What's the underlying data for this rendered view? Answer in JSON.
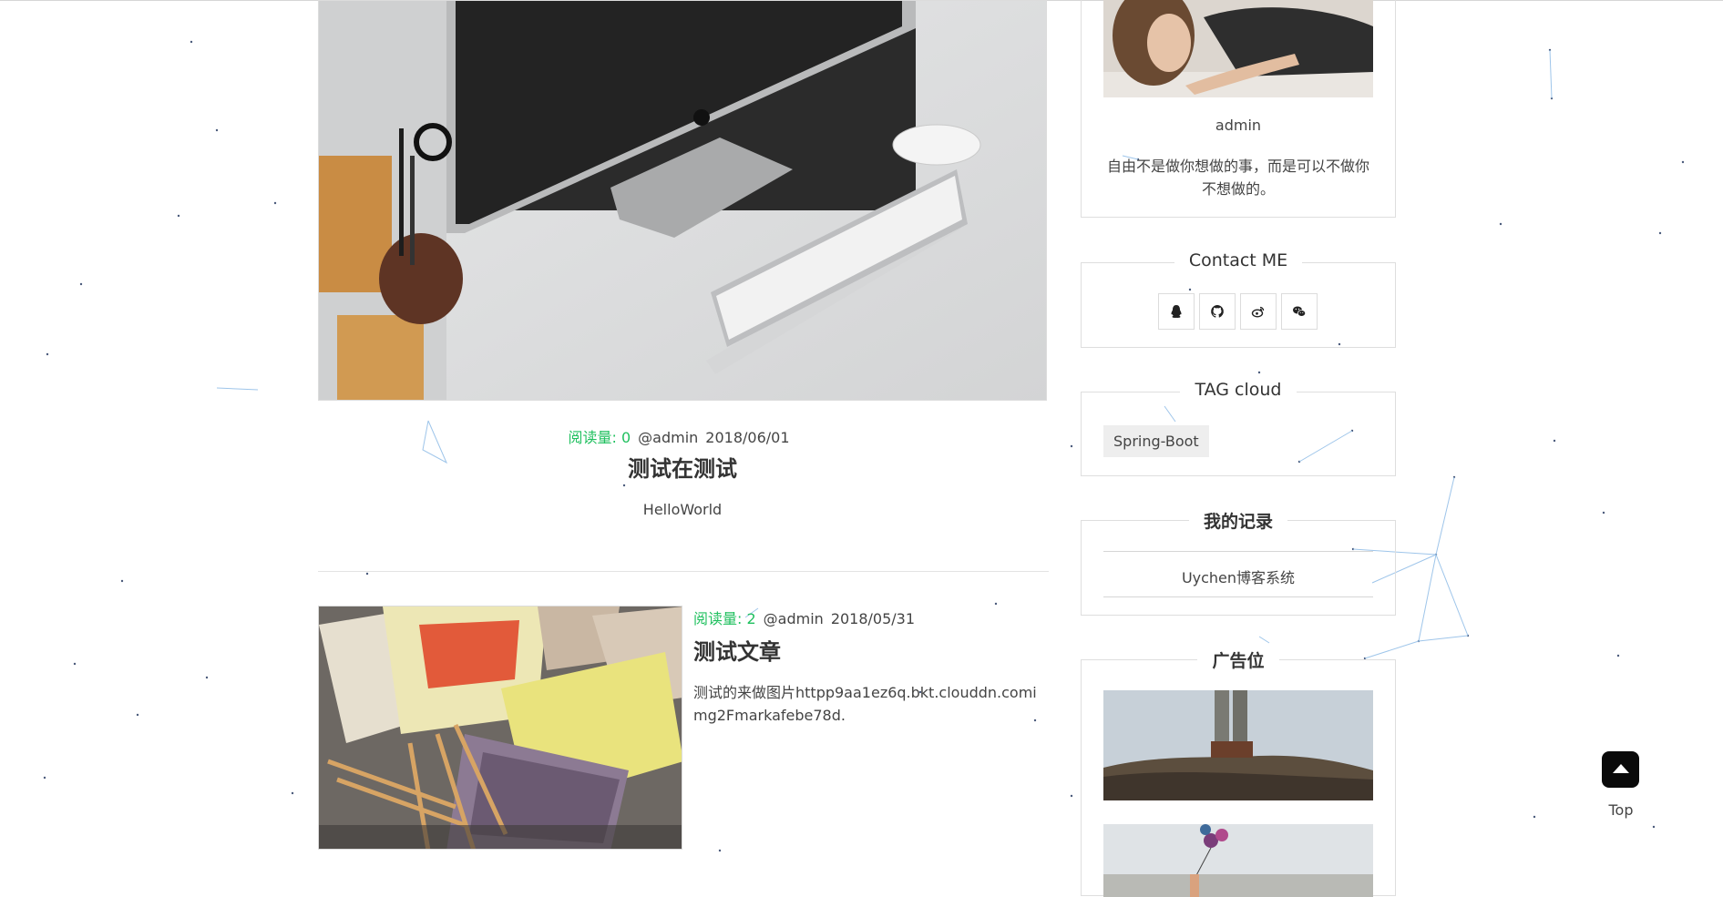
{
  "post1": {
    "reads_label": "阅读量: 0",
    "author": "@admin",
    "date": "2018/06/01",
    "title": "测试在测试",
    "excerpt": "HelloWorld"
  },
  "post2": {
    "reads_label": "阅读量: 2",
    "author": "@admin",
    "date": "2018/05/31",
    "title": "测试文章",
    "excerpt": "测试的来做图片httpp9aa1ez6q.bkt.clouddn.comimg2Fmarkafebe78d."
  },
  "sidebar": {
    "profile": {
      "name": "admin",
      "motto": "自由不是做你想做的事，而是可以不做你不想做的。"
    },
    "contact": {
      "title": "Contact ME",
      "icons": [
        "qq-icon",
        "github-icon",
        "weibo-icon",
        "wechat-icon"
      ]
    },
    "tags": {
      "title": "TAG cloud",
      "items": [
        "Spring-Boot"
      ]
    },
    "records": {
      "title": "我的记录",
      "items": [
        "Uychen博客系统"
      ]
    },
    "ads": {
      "title": "广告位"
    }
  },
  "top_button": {
    "label": "Top"
  },
  "colors": {
    "accent_green": "#20c05f",
    "border": "#dedede",
    "network_line": "#9ec5ea"
  }
}
